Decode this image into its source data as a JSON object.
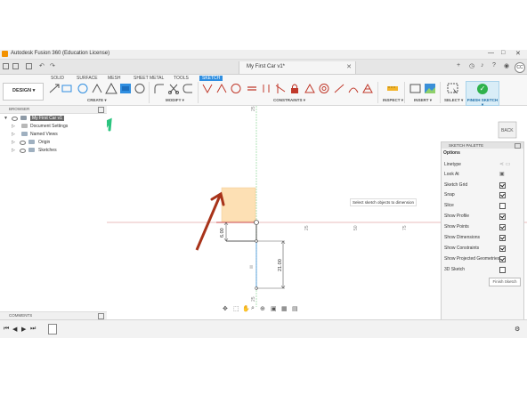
{
  "window": {
    "title": "Autodesk Fusion 360 (Education License)",
    "minimize": "—",
    "maximize": "□",
    "close": "✕"
  },
  "tabbar": {
    "document_title": "My First Car v1*",
    "close": "✕",
    "plus": "+",
    "avatar": "CC",
    "right_icons": [
      "plus-icon",
      "clock-icon",
      "bell-icon",
      "question-icon",
      "avatar-icon"
    ]
  },
  "ribbon": {
    "tabs": [
      "SOLID",
      "SURFACE",
      "MESH",
      "SHEET METAL",
      "TOOLS",
      "SKETCH"
    ],
    "active_tab": "SKETCH",
    "workspace": "DESIGN ▾",
    "groups": [
      "CREATE ▾",
      "MODIFY ▾",
      "CONSTRAINTS ▾",
      "INSPECT ▾",
      "INSERT ▾",
      "SELECT ▾"
    ],
    "finish_sketch": "FINISH SKETCH ▾"
  },
  "browser": {
    "title": "BROWSER",
    "items": [
      {
        "label": "My First Car v1",
        "icon": "component-icon"
      },
      {
        "label": "Document Settings",
        "icon": "settings-icon"
      },
      {
        "label": "Named Views",
        "icon": "folder-icon"
      },
      {
        "label": "Origin",
        "icon": "folder-icon"
      },
      {
        "label": "Sketches",
        "icon": "folder-icon"
      }
    ]
  },
  "canvas": {
    "axis_labels": [
      "25",
      "25",
      "50",
      "75",
      "25"
    ],
    "dim_horizontal": "6.00",
    "dim_vertical": "21.00",
    "tooltip": "Select sketch objects to dimension",
    "viewcube": "BACK",
    "dim_mark": "||||"
  },
  "palette": {
    "title": "SKETCH PALETTE",
    "section": "Options",
    "rows": [
      {
        "label": "Linetype",
        "checked": null
      },
      {
        "label": "Look At",
        "checked": null
      },
      {
        "label": "Sketch Grid",
        "checked": true
      },
      {
        "label": "Snap",
        "checked": true
      },
      {
        "label": "Slice",
        "checked": false
      },
      {
        "label": "Show Profile",
        "checked": true
      },
      {
        "label": "Show Points",
        "checked": true
      },
      {
        "label": "Show Dimensions",
        "checked": true
      },
      {
        "label": "Show Constraints",
        "checked": true
      },
      {
        "label": "Show Projected Geometries",
        "checked": true
      },
      {
        "label": "3D Sketch",
        "checked": false
      }
    ],
    "finish_button": "Finish Sketch"
  },
  "comments": {
    "title": "COMMENTS"
  },
  "timeline": {
    "buttons": [
      "⏮",
      "◀",
      "▶",
      "⏭"
    ],
    "settings": "⚙"
  },
  "annotations": {
    "green": "#2bc47f",
    "red": "#a8331a",
    "accent": "#2f8ee0",
    "profile_fill": "#fde0b4"
  }
}
